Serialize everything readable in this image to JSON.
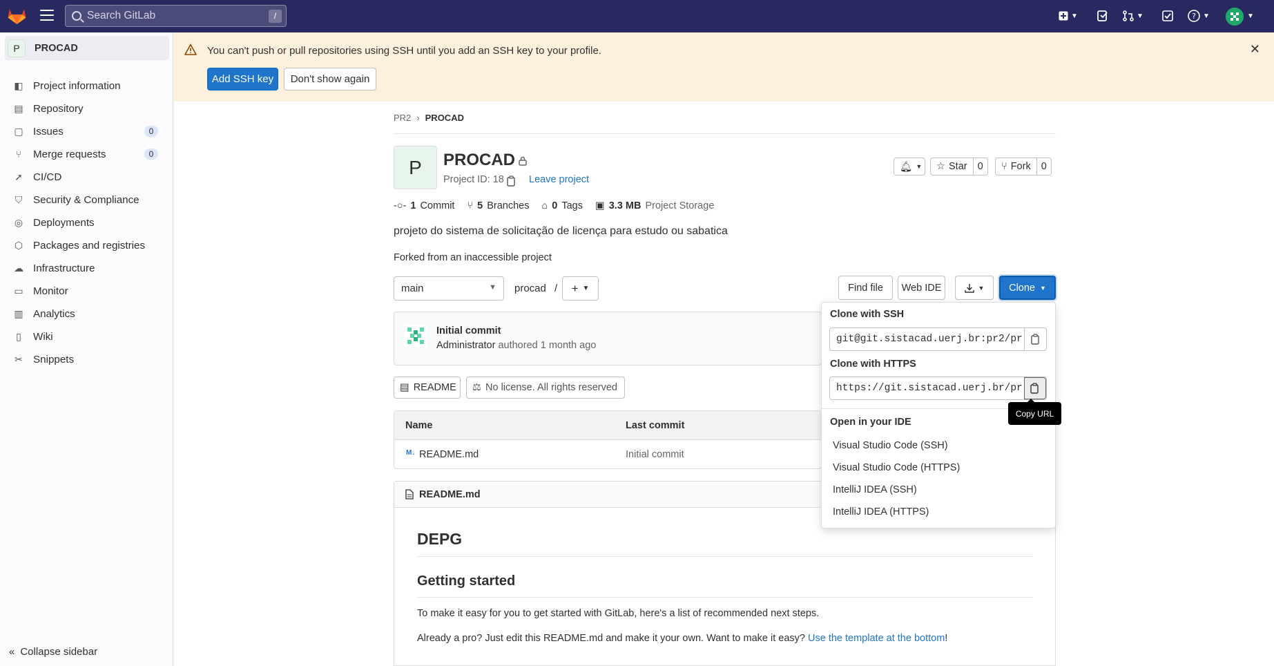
{
  "topbar": {
    "search_placeholder": "Search GitLab",
    "search_shortcut": "/",
    "icons": [
      "plus-square-icon",
      "issues-icon",
      "merge-request-icon",
      "todo-icon",
      "help-icon",
      "avatar"
    ]
  },
  "sidebar": {
    "project_letter": "P",
    "project_name": "PROCAD",
    "items": [
      {
        "label": "Project information",
        "icon": "project-icon"
      },
      {
        "label": "Repository",
        "icon": "doc-icon"
      },
      {
        "label": "Issues",
        "icon": "issues-icon",
        "badge": "0"
      },
      {
        "label": "Merge requests",
        "icon": "merge-request-icon",
        "badge": "0"
      },
      {
        "label": "CI/CD",
        "icon": "rocket-icon"
      },
      {
        "label": "Security & Compliance",
        "icon": "shield-icon"
      },
      {
        "label": "Deployments",
        "icon": "deployments-icon"
      },
      {
        "label": "Packages and registries",
        "icon": "package-icon"
      },
      {
        "label": "Infrastructure",
        "icon": "cloud-icon"
      },
      {
        "label": "Monitor",
        "icon": "monitor-icon"
      },
      {
        "label": "Analytics",
        "icon": "chart-icon"
      },
      {
        "label": "Wiki",
        "icon": "book-icon"
      },
      {
        "label": "Snippets",
        "icon": "scissors-icon"
      }
    ],
    "collapse_label": "Collapse sidebar"
  },
  "banner": {
    "message": "You can't push or pull repositories using SSH until you add an SSH key to your profile.",
    "add_key_label": "Add SSH key",
    "dont_show_label": "Don't show again"
  },
  "breadcrumb": {
    "group": "PR2",
    "project": "PROCAD"
  },
  "project": {
    "letter": "P",
    "name": "PROCAD",
    "id_text": "Project ID: 18",
    "leave_label": "Leave project",
    "star_label": "Star",
    "star_count": "0",
    "fork_label": "Fork",
    "fork_count": "0",
    "stats": {
      "commits_num": "1",
      "commits_label": "Commit",
      "branches_num": "5",
      "branches_label": "Branches",
      "tags_num": "0",
      "tags_label": "Tags",
      "storage_num": "3.3 MB",
      "storage_label": "Project Storage"
    },
    "description": "projeto do sistema de solicitação de licença para estudo ou sabatica",
    "forked_from": "Forked from an inaccessible project"
  },
  "toolbar": {
    "branch": "main",
    "path": "procad",
    "path_sep": "/",
    "find_file": "Find file",
    "web_ide": "Web IDE",
    "clone": "Clone"
  },
  "commit": {
    "title": "Initial commit",
    "author": "Administrator",
    "meta": "authored 1 month ago"
  },
  "pills": {
    "readme": "README",
    "license": "No license. All rights reserved"
  },
  "file_table": {
    "columns": [
      "Name",
      "Last commit"
    ],
    "rows": [
      {
        "name": "README.md",
        "last_commit": "Initial commit",
        "badge": "M↓"
      }
    ]
  },
  "readme": {
    "filename": "README.md",
    "h1": "DEPG",
    "h2": "Getting started",
    "p1": "To make it easy for you to get started with GitLab, here's a list of recommended next steps.",
    "p2_pre": "Already a pro? Just edit this README.md and make it your own. Want to make it easy? ",
    "p2_link": "Use the template at the bottom",
    "p2_post": "!"
  },
  "clone_dropdown": {
    "ssh_label": "Clone with SSH",
    "ssh_url": "git@git.sistacad.uerj.br:pr2/pr",
    "https_label": "Clone with HTTPS",
    "https_url": "https://git.sistacad.uerj.br/pr",
    "ide_label": "Open in your IDE",
    "ide_items": [
      "Visual Studio Code (SSH)",
      "Visual Studio Code (HTTPS)",
      "IntelliJ IDEA (SSH)",
      "IntelliJ IDEA (HTTPS)"
    ],
    "tooltip": "Copy URL"
  },
  "colors": {
    "primary": "#1f75cb",
    "topbar": "#292961",
    "banner": "#fdf1dd"
  }
}
